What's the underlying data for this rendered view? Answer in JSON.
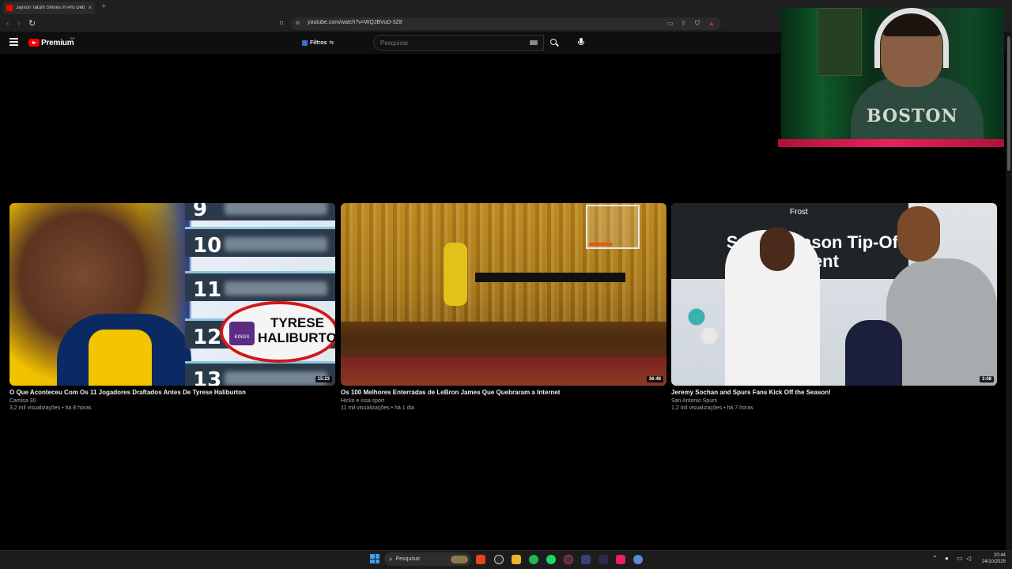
{
  "browser": {
    "tab_title": "Jayson Tatum Shines In Pro Debut",
    "tab_close": "×",
    "new_tab": "+",
    "url": "youtube.com/watch?v=WQJBVuD-3Z8"
  },
  "youtube_header": {
    "logo_label": "Premium",
    "country_code": "BR",
    "filter_label": "Filtros",
    "search_placeholder": "Pesquisar"
  },
  "webcam": {
    "hoodie_text": "BOSTON"
  },
  "videos": [
    {
      "title": "O Que Aconteceu Com Os 11 Jogadores Draftados Antes De Tyrese Haliburton",
      "channel": "Camisa 30",
      "meta": "3,2 mil visualizações • há 8 horas",
      "duration": "15:23",
      "thumb_ranks": [
        "9",
        "10",
        "11",
        "12",
        "13"
      ],
      "thumb_highlight": "TYRESE HALIBURTON",
      "thumb_team": "KINGS"
    },
    {
      "title": "Os 100 Melhores Enterradas de LeBron James Que Quebraram a Internet",
      "channel": "Hicko e issa sport",
      "meta": "11 mil visualizações • há 1 dia",
      "duration": "36:48"
    },
    {
      "title": "Jeremy Sochan and Spurs Fans Kick Off the Season!",
      "channel": "San Antonio Spurs",
      "meta": "1,2 mil visualizações • há 7 horas",
      "duration": "3:08",
      "thumb_banner": "Spurs Season Tip-Off Event",
      "thumb_sponsor": "Frost"
    }
  ],
  "taskbar": {
    "search_label": "Pesquisar",
    "time": "20:44",
    "date": "24/10/2025"
  },
  "colors": {
    "youtube_red": "#ff0000",
    "page_bg": "#000000",
    "header_bg": "#0f0f0f",
    "webcam_bar": "#e8215a"
  }
}
